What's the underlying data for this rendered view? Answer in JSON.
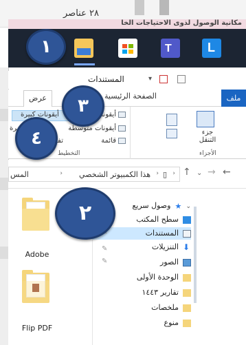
{
  "top": {
    "item_count": "٢٨ عناصر",
    "banner_text": "مكانية الوصول لذوى الاحتياجات الخا"
  },
  "taskbar": {
    "icons": [
      "file-explorer-icon",
      "microsoft-store-icon",
      "teams-icon",
      "app-l-icon"
    ],
    "app_l_letter": "L"
  },
  "window": {
    "title": "المستندات",
    "tabs": {
      "file": "ملف",
      "home": "الصفحة الرئيسية",
      "view": "عرض"
    }
  },
  "ribbon": {
    "panes_label": "الأجزاء",
    "nav_pane_label": "جزء التنقل",
    "layout_label": "التخطيط",
    "layout_items": [
      "أيقونات كبيرة",
      "أيقونات كبيرة",
      "أيقونات متوسطة",
      "أيقونات كبيرة",
      "قائمة",
      "تفاصيل"
    ]
  },
  "address": {
    "crumbs": [
      "هذا الكمبيوتر الشخصي",
      "المس"
    ]
  },
  "files": [
    {
      "name": "Adobe"
    },
    {
      "name": "Flip PDF"
    }
  ],
  "nav_tree": [
    {
      "label": "وصول سريع"
    },
    {
      "label": "سطح المكتب"
    },
    {
      "label": "المستندات"
    },
    {
      "label": "التنزيلات"
    },
    {
      "label": "الصور"
    },
    {
      "label": "الوحدة الأولى"
    },
    {
      "label": "تقارير ١٤٤٣"
    },
    {
      "label": "ملخصات"
    },
    {
      "label": "منوع"
    }
  ],
  "callouts": [
    "١",
    "٢",
    "٣",
    "٤"
  ],
  "colors": {
    "callout": "#2f5597",
    "file_tab": "#1a65c2",
    "taskbar": "#1c2533",
    "selection": "#cde8ff"
  }
}
